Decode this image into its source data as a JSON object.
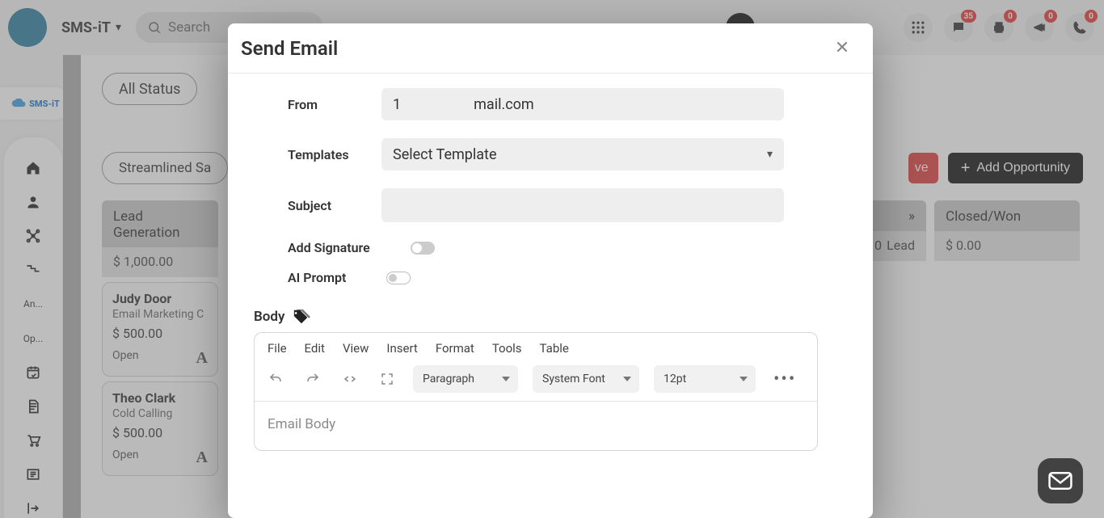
{
  "topbar": {
    "brand": "SMS-iT",
    "search_placeholder": "Search",
    "badges": {
      "chat": "35",
      "print": "0",
      "announce": "0",
      "phone": "0"
    }
  },
  "sidebar": {
    "logo_text": "SMS-iT",
    "items": {
      "analytics_label": "An...",
      "opportunities_label": "Op..."
    }
  },
  "main": {
    "filter_label": "All Status",
    "pipeline_label": "Streamlined Sa",
    "save_partial": "ve",
    "add_opp_label": "Add Opportunity",
    "columns": {
      "leadgen": {
        "title": "Lead Generation",
        "subtotal": "$ 1,000.00"
      },
      "closed": {
        "title": "Closed/Won",
        "subtotal": "$ 0.00"
      },
      "clue": {
        "sub_left_fragment": "0",
        "sub_right": "Lead"
      }
    },
    "cards": {
      "judy": {
        "name": "Judy Door",
        "sub": "Email Marketing C",
        "amt": "$ 500.00",
        "status": "Open"
      },
      "theo": {
        "name": "Theo Clark",
        "sub": "Cold Calling",
        "amt": "$ 500.00",
        "status": "Open"
      }
    }
  },
  "modal": {
    "title": "Send Email",
    "labels": {
      "from": "From",
      "templates": "Templates",
      "subject": "Subject",
      "add_signature": "Add Signature",
      "ai_prompt": "AI Prompt",
      "body": "Body"
    },
    "from_value_prefix": "1",
    "from_value_suffix": "mail.com",
    "templates_placeholder": "Select Template",
    "editor": {
      "menus": {
        "file": "File",
        "edit": "Edit",
        "view": "View",
        "insert": "Insert",
        "format": "Format",
        "tools": "Tools",
        "table": "Table"
      },
      "select_paragraph": "Paragraph",
      "select_font": "System Font",
      "select_size": "12pt",
      "body_placeholder": "Email Body"
    }
  }
}
